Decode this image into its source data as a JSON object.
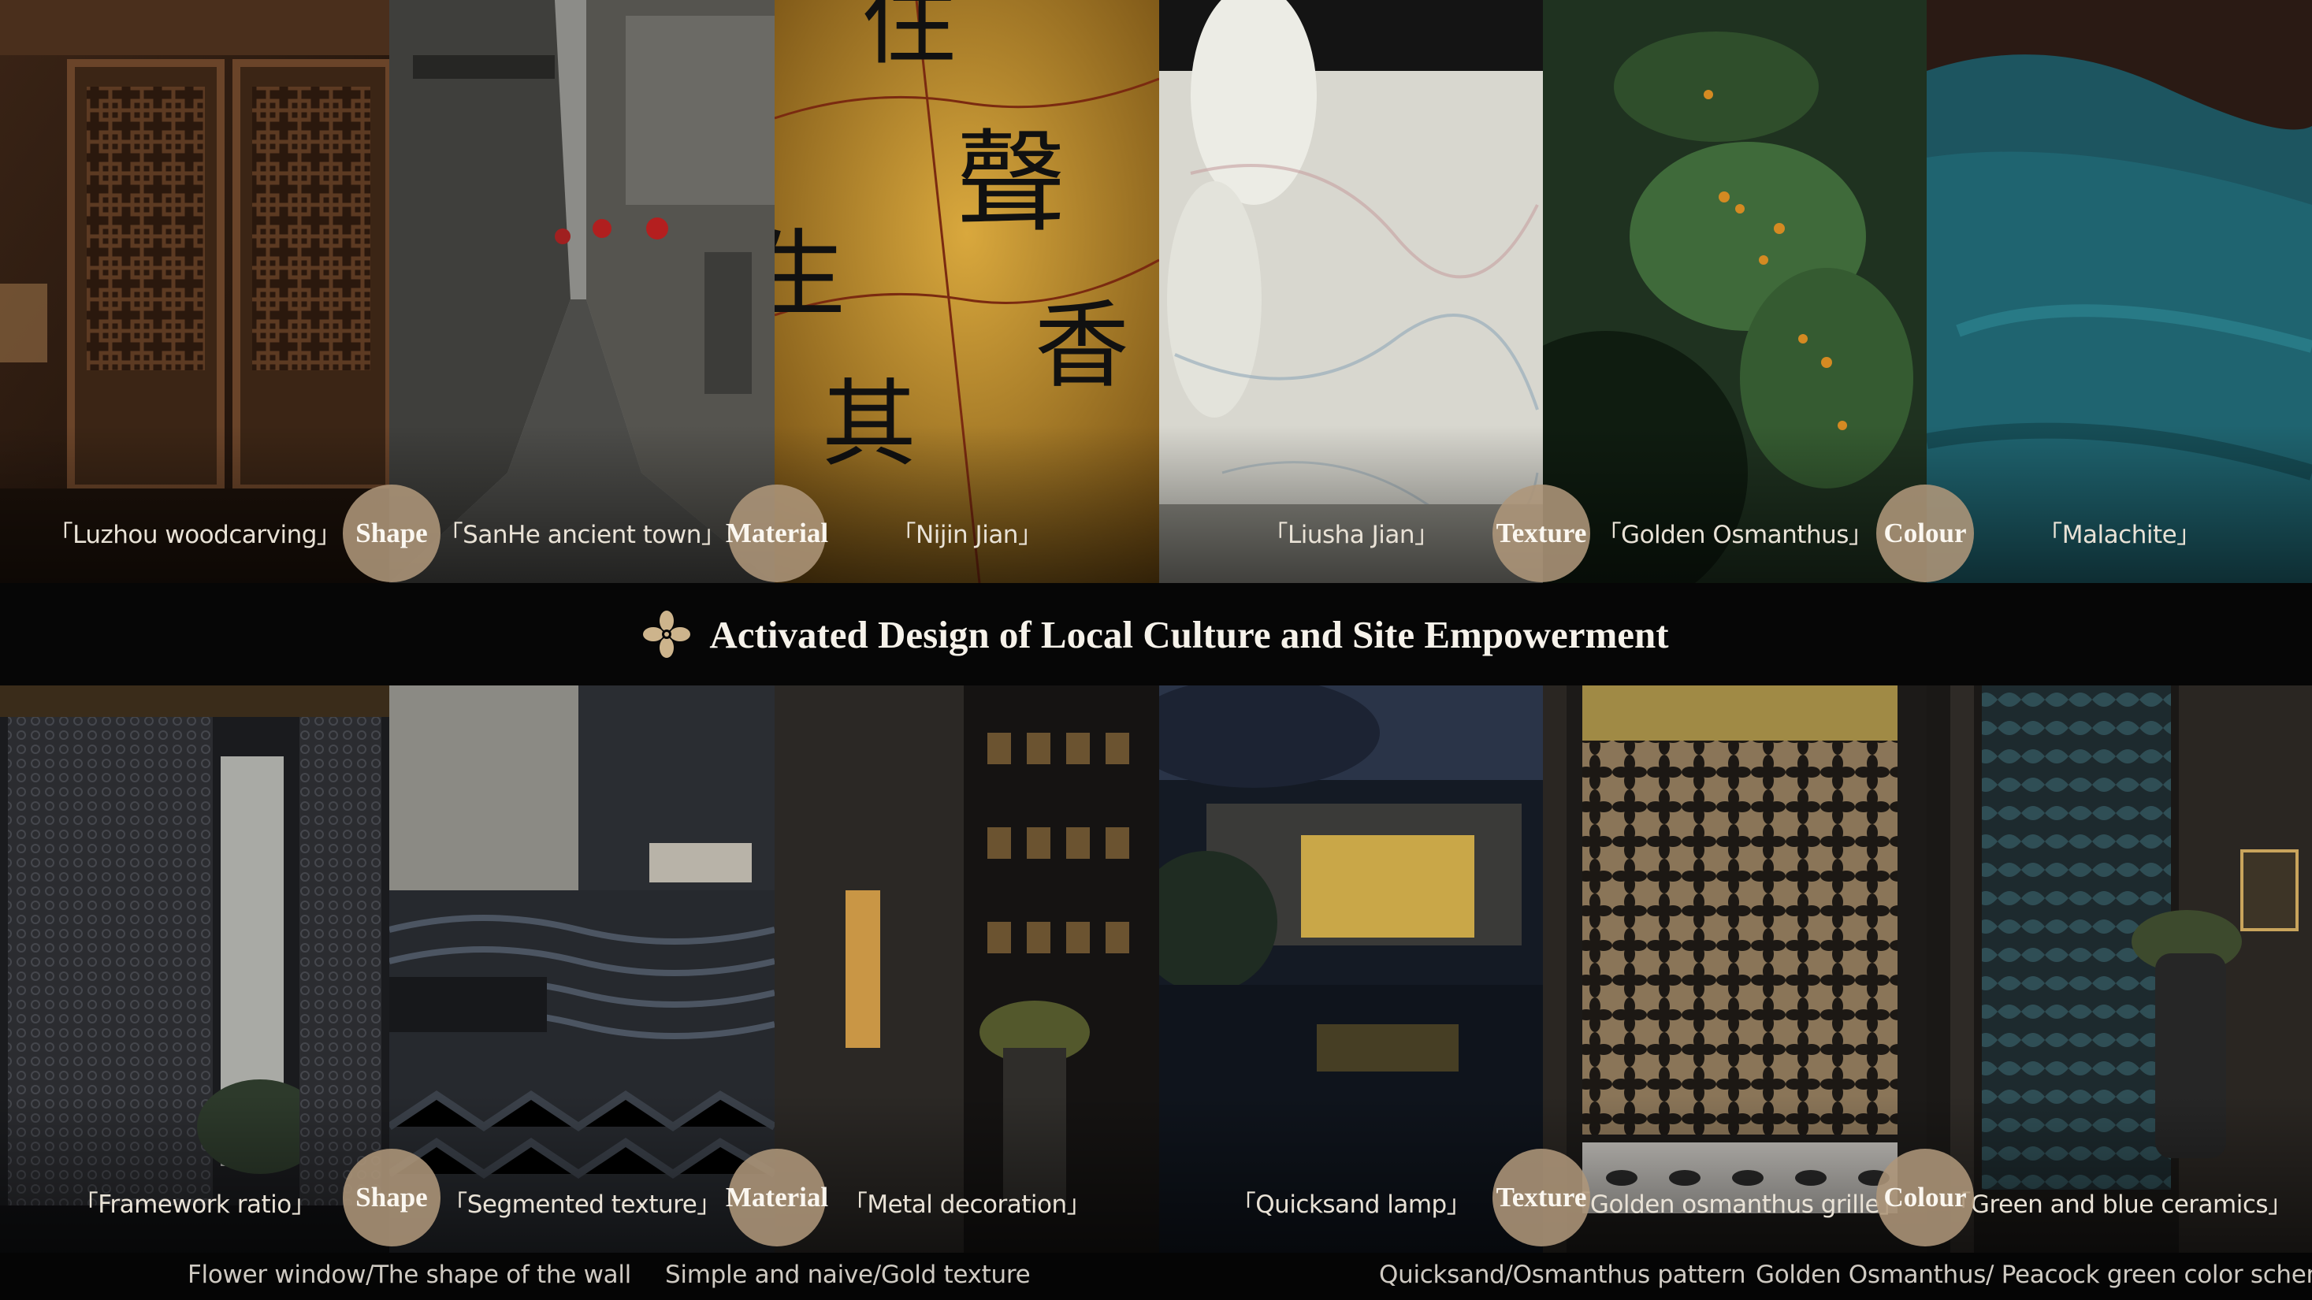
{
  "title": "Activated Design of Local Culture and Site Empowerment",
  "top_row": [
    {
      "label": "「Luzhou woodcarving」",
      "image": "lattice wooden door"
    },
    {
      "label": "「SanHe ancient town」",
      "image": "ancient town alley"
    },
    {
      "label": "「Nijin Jian」",
      "image": "gold paper calligraphy"
    },
    {
      "label": "「Liusha Jian」",
      "image": "marbled paper scroll"
    },
    {
      "label": "「Golden Osmanthus」",
      "image": "osmanthus branch"
    },
    {
      "label": "「Malachite」",
      "image": "malachite stone"
    }
  ],
  "bottom_row": [
    {
      "label": "「Framework ratio」",
      "image": "lattice screen entrance"
    },
    {
      "label": "「Segmented texture」",
      "image": "wave patterned stone landscape"
    },
    {
      "label": "「Metal decoration」",
      "image": "dark wall with gold strip"
    },
    {
      "label": "「Quicksand lamp」",
      "image": "night water courtyard"
    },
    {
      "label": "「Golden osmanthus grille」",
      "image": "flower pattern grille screen"
    },
    {
      "label": "「Green and blue ceramics」",
      "image": "glazed ceramic wall"
    }
  ],
  "badges": [
    "Shape",
    "Material",
    "Texture",
    "Colour"
  ],
  "captions": [
    "Flower window/The shape of the wall",
    "Simple and naive/Gold texture",
    "Quicksand/Osmanthus pattern",
    "Golden Osmanthus/ Peacock green color scheme"
  ],
  "calligraphy": [
    "住",
    "聲",
    "生",
    "其",
    "香"
  ],
  "icons": {
    "title_icon": "flower-ornament-icon"
  },
  "colors": {
    "badge": "#ae967a",
    "background": "#050505",
    "title": "#f6f2ea"
  }
}
